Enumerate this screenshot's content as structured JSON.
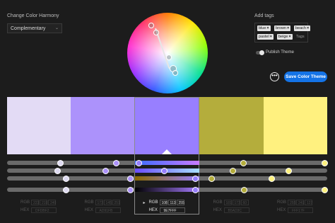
{
  "harmony": {
    "label": "Change Color Harmony",
    "selected": "Complementary"
  },
  "tags": {
    "label": "Add tags",
    "items": [
      "blue",
      "brown",
      "beach",
      "pastel",
      "beige"
    ],
    "placeholder": "Tags"
  },
  "publish": {
    "label": "Publish Theme"
  },
  "actions": {
    "more": "•••",
    "save": "Save Color Theme"
  },
  "swatches": [
    {
      "color": "#e3dbf5",
      "rgb": [
        "223",
        "219",
        "240"
      ],
      "hex": "DFDBF2"
    },
    {
      "color": "#ac92fb",
      "rgb": [
        "173",
        "145",
        "251"
      ],
      "hex": "AD91FB"
    },
    {
      "color": "#987fff",
      "rgb": [
        "108",
        "113",
        "255"
      ],
      "hex": "9E7FFF"
    },
    {
      "color": "#b4ad3c",
      "rgb": [
        "181",
        "173",
        "60"
      ],
      "hex": "B5AD3C"
    },
    {
      "color": "#fff17f",
      "rgb": [
        "255",
        "241",
        "127"
      ],
      "hex": "FFF17F"
    }
  ],
  "active_index": 2,
  "value_labels": {
    "rgb": "RGB",
    "hex": "HEX"
  },
  "icons": {
    "close": "close-icon",
    "chevron": "chevron-down-icon"
  }
}
